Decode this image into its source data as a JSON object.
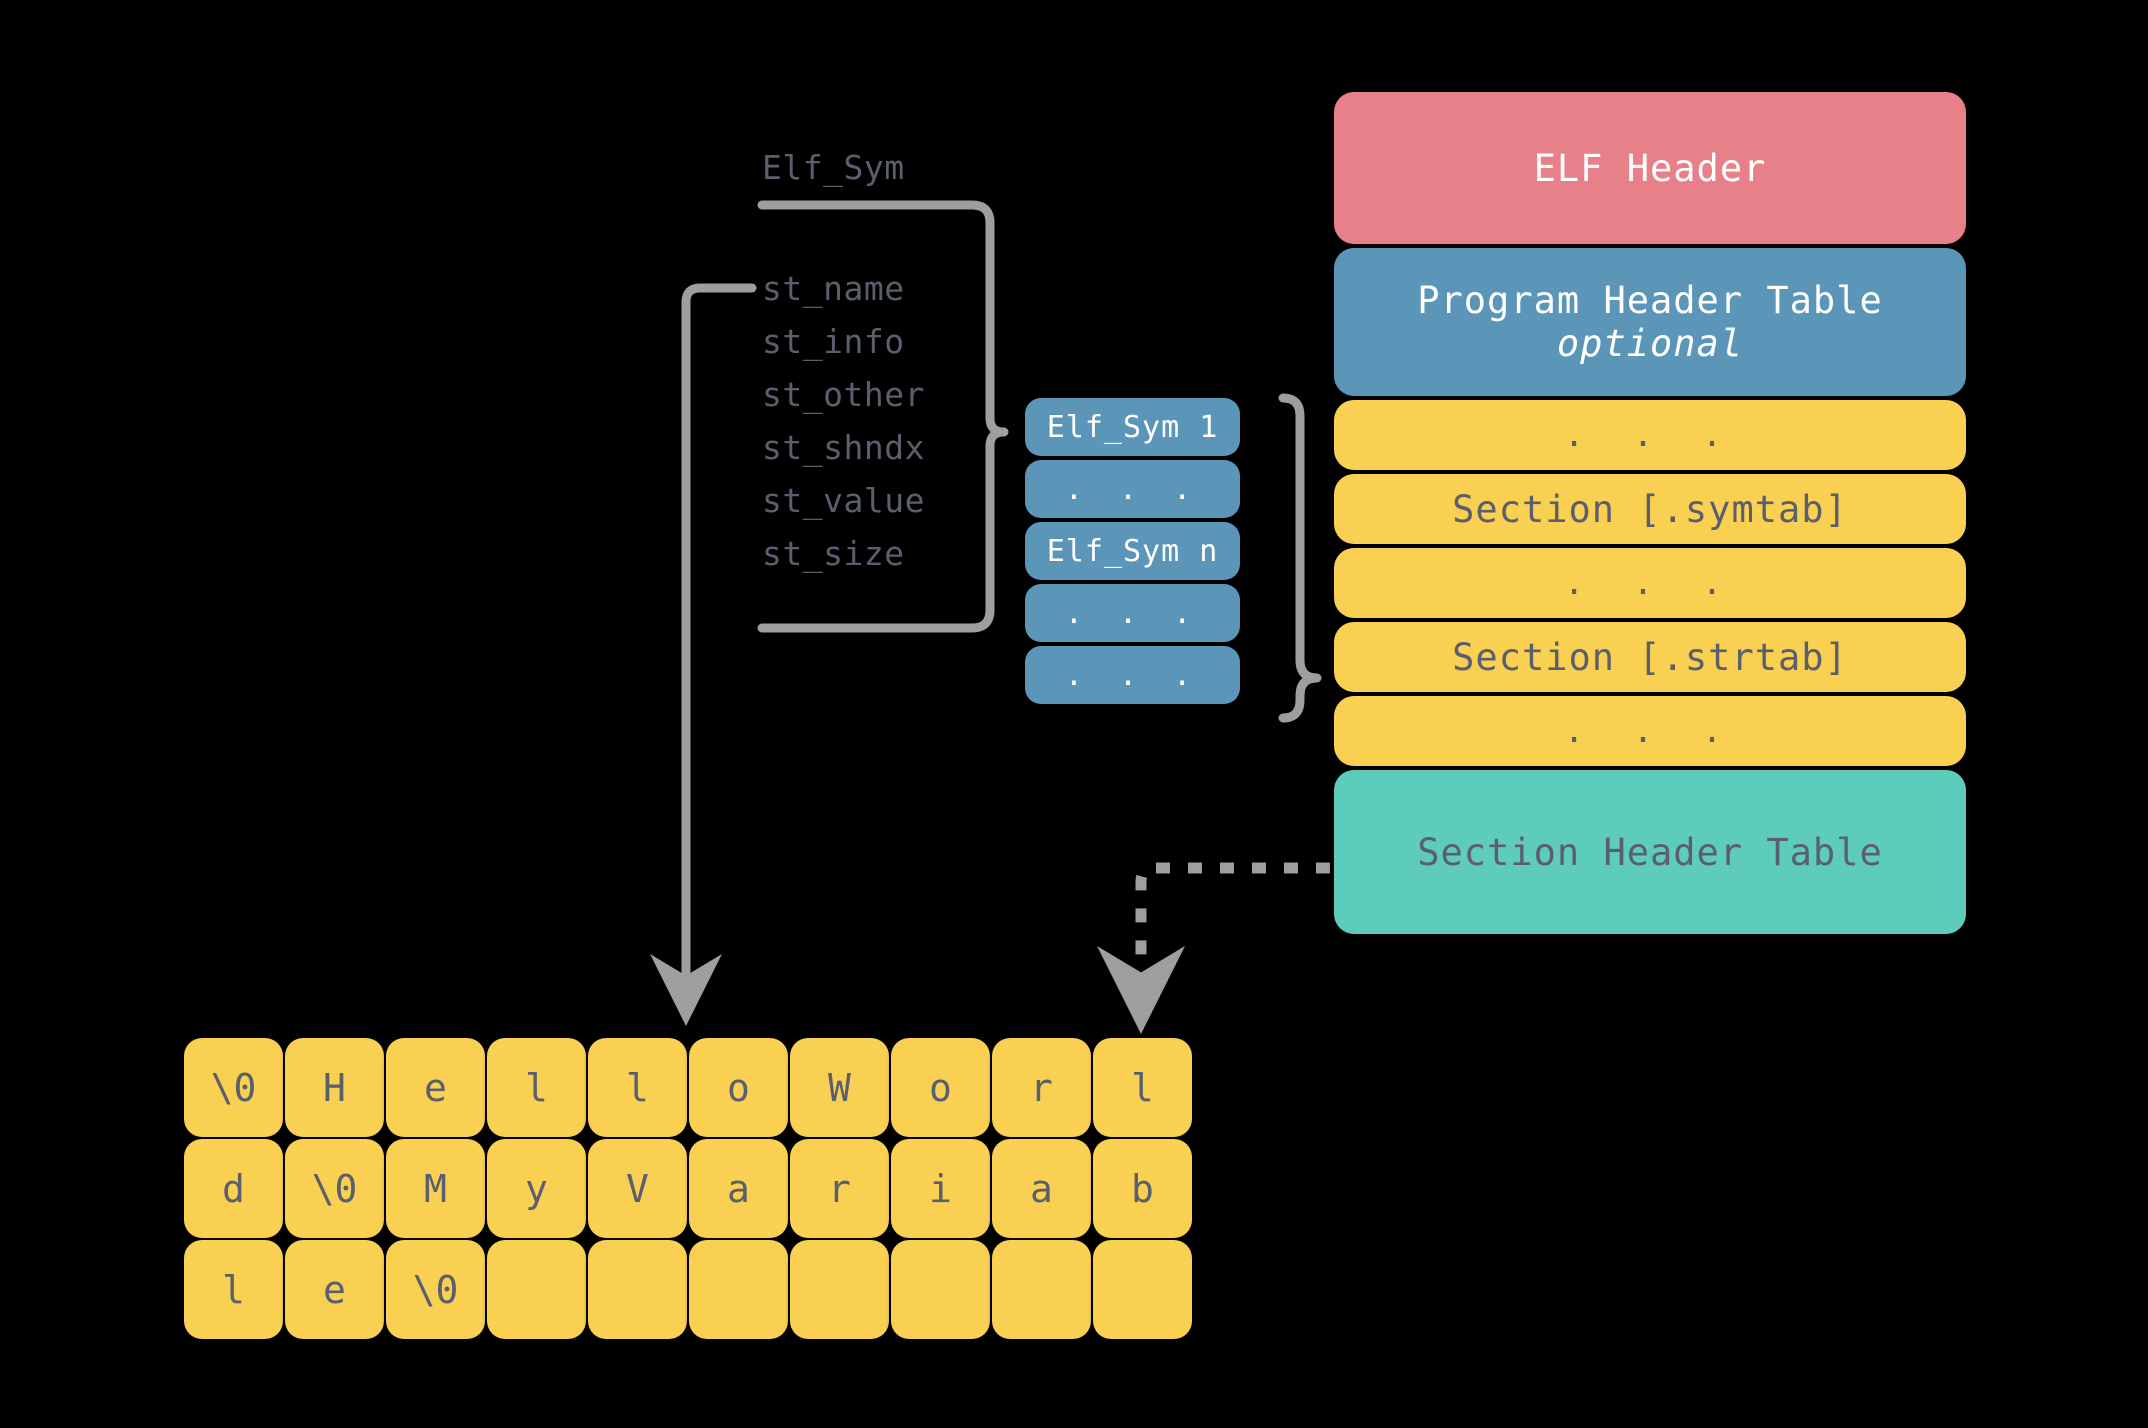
{
  "struct": {
    "title": "Elf_Sym",
    "fields": [
      "st_name",
      "st_info",
      "st_other",
      "st_shndx",
      "st_value",
      "st_size"
    ]
  },
  "symbol_stack": {
    "cells": [
      "Elf_Sym 1",
      ". . .",
      "Elf_Sym n",
      ". . .",
      ". . ."
    ]
  },
  "elf_layout": {
    "boxes": [
      {
        "line1": "ELF Header",
        "line2": "",
        "color": "#e8808a",
        "kind": "red"
      },
      {
        "line1": "Program Header Table",
        "line2": "optional",
        "color": "#5b96b8",
        "kind": "blue"
      },
      {
        "line1": ". . .",
        "line2": "",
        "color": "#f9d051",
        "kind": "yellow-dots"
      },
      {
        "line1": "Section [.symtab]",
        "line2": "",
        "color": "#f9d051",
        "kind": "yellow"
      },
      {
        "line1": ". . .",
        "line2": "",
        "color": "#f9d051",
        "kind": "yellow-dots"
      },
      {
        "line1": "Section [.strtab]",
        "line2": "",
        "color": "#f9d051",
        "kind": "yellow"
      },
      {
        "line1": ". . .",
        "line2": "",
        "color": "#f9d051",
        "kind": "yellow-dots"
      },
      {
        "line1": "Section Header Table",
        "line2": "",
        "color": "#5eccbb",
        "kind": "teal"
      }
    ]
  },
  "string_table": {
    "columns": 10,
    "rows": [
      [
        "\\0",
        "H",
        "e",
        "l",
        "l",
        "o",
        "W",
        "o",
        "r",
        "l"
      ],
      [
        "d",
        "\\0",
        "M",
        "y",
        "V",
        "a",
        "r",
        "i",
        "a",
        "b"
      ],
      [
        "l",
        "e",
        "\\0",
        "",
        "",
        "",
        "",
        "",
        "",
        ""
      ]
    ]
  },
  "colors": {
    "background": "#000000",
    "connector": "#9e9e9e",
    "text_dark": "#5a5f6e",
    "text_light": "#ffffff",
    "red": "#e8808a",
    "blue": "#5b96b8",
    "yellow": "#f9d051",
    "teal": "#5eccbb"
  }
}
